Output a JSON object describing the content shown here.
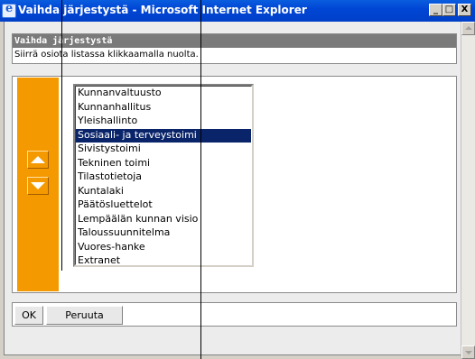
{
  "window": {
    "title": "Vaihda järjestystä - Microsoft Internet Explorer",
    "minimize_label": "_",
    "maximize_label": "□",
    "close_label": "X"
  },
  "header": {
    "title": "Vaihda järjestystä",
    "description": "Siirrä osiota listassa klikkaamalla nuolta."
  },
  "list": {
    "items": [
      "Kunnanvaltuusto",
      "Kunnanhallitus",
      "Yleishallinto",
      "Sosiaali- ja terveystoimi",
      "Sivistystoimi",
      "Tekninen toimi",
      "Tilastotietoja",
      "Kuntalaki",
      "Päätösluettelot",
      "Lempäälän kunnan visio",
      "Taloussuunnitelma",
      "Vuores-hanke",
      "Extranet"
    ],
    "selected_index": 3
  },
  "buttons": {
    "ok": "OK",
    "cancel": "Peruuta"
  },
  "colors": {
    "titlebar": "#0046d5",
    "accent_orange": "#f49a00",
    "selection": "#0a246a",
    "header_bar": "#7a7a7a"
  }
}
